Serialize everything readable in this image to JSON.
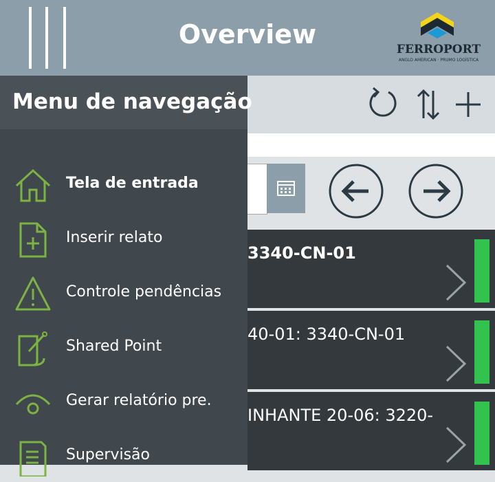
{
  "header": {
    "title": "Overview",
    "logo_text": "FERROPORT",
    "logo_subtext": "ANGLO AMERICAN · PRUMO LOGÍSTICA"
  },
  "toolbar": {
    "icons": [
      "refresh-icon",
      "sort-icon",
      "add-icon"
    ]
  },
  "list": {
    "items": [
      {
        "text": "3340-CN-01"
      },
      {
        "text": "40-01: 3340-CN-01"
      },
      {
        "text": "INHANTE 20-06: 3220-"
      }
    ]
  },
  "drawer": {
    "title": "Menu de navegação",
    "items": [
      {
        "label": "Tela de entrada",
        "icon": "home-icon",
        "active": true
      },
      {
        "label": "Inserir relato",
        "icon": "add-document-icon"
      },
      {
        "label": "Controle pendências",
        "icon": "warning-icon"
      },
      {
        "label": "Shared Point",
        "icon": "edit-note-icon"
      },
      {
        "label": "Gerar relatório pre.",
        "icon": "eye-icon"
      },
      {
        "label": "Supervisão",
        "icon": "list-document-icon"
      }
    ]
  },
  "colors": {
    "header_bg": "#8b9ea9",
    "drawer_bg": "#41484d",
    "icon_green": "#7cb342",
    "status_green": "#33c24d",
    "list_bg": "#34393d"
  }
}
